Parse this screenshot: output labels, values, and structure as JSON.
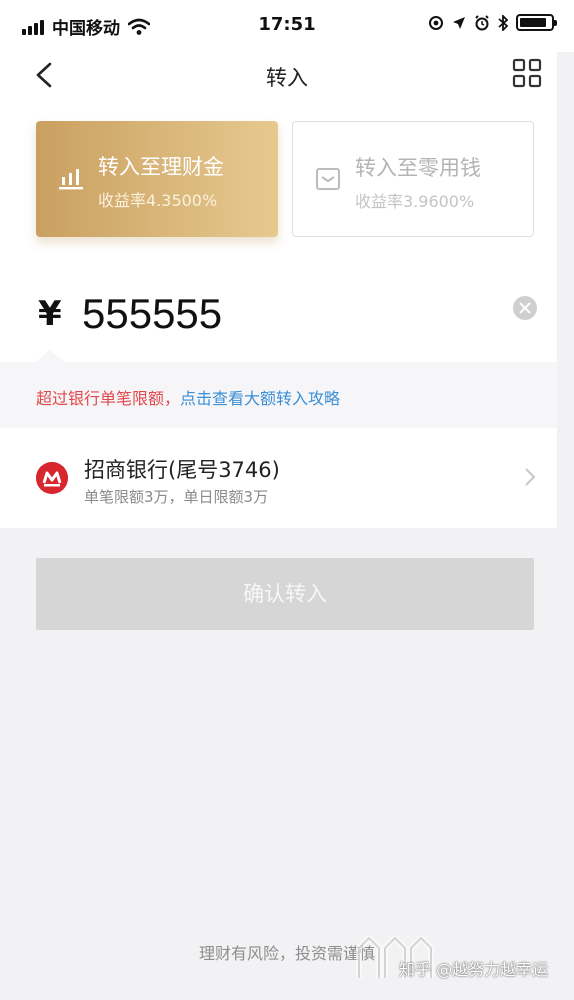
{
  "status_bar": {
    "carrier": "中国移动",
    "time": "17:51",
    "battery_level": 0.85
  },
  "nav": {
    "title": "转入",
    "back_icon": "chevron-left-icon",
    "menu_icon": "grid-icon"
  },
  "options": [
    {
      "title": "转入至理财金",
      "rate": "收益率4.3500%",
      "selected": true,
      "icon": "bar-chart-icon"
    },
    {
      "title": "转入至零用钱",
      "rate": "收益率3.9600%",
      "selected": false,
      "icon": "wallet-icon"
    }
  ],
  "amount": {
    "currency": "¥",
    "value": "555555"
  },
  "tip": {
    "warning": "超过银行单笔限额，",
    "link": "点击查看大额转入攻略"
  },
  "bank": {
    "name": "招商银行(尾号3746)",
    "limit": "单笔限额3万，单日限额3万"
  },
  "confirm_label": "确认转入",
  "risk_notice": "理财有风险，投资需谨慎",
  "watermark": "知乎 @越努力越幸运",
  "colors": {
    "gold_start": "#c9a061",
    "gold_end": "#e7c98f",
    "warning": "#e2474b",
    "link": "#3a8fd6",
    "bank_red": "#d7262e",
    "disabled_button": "#d6d6d6"
  }
}
